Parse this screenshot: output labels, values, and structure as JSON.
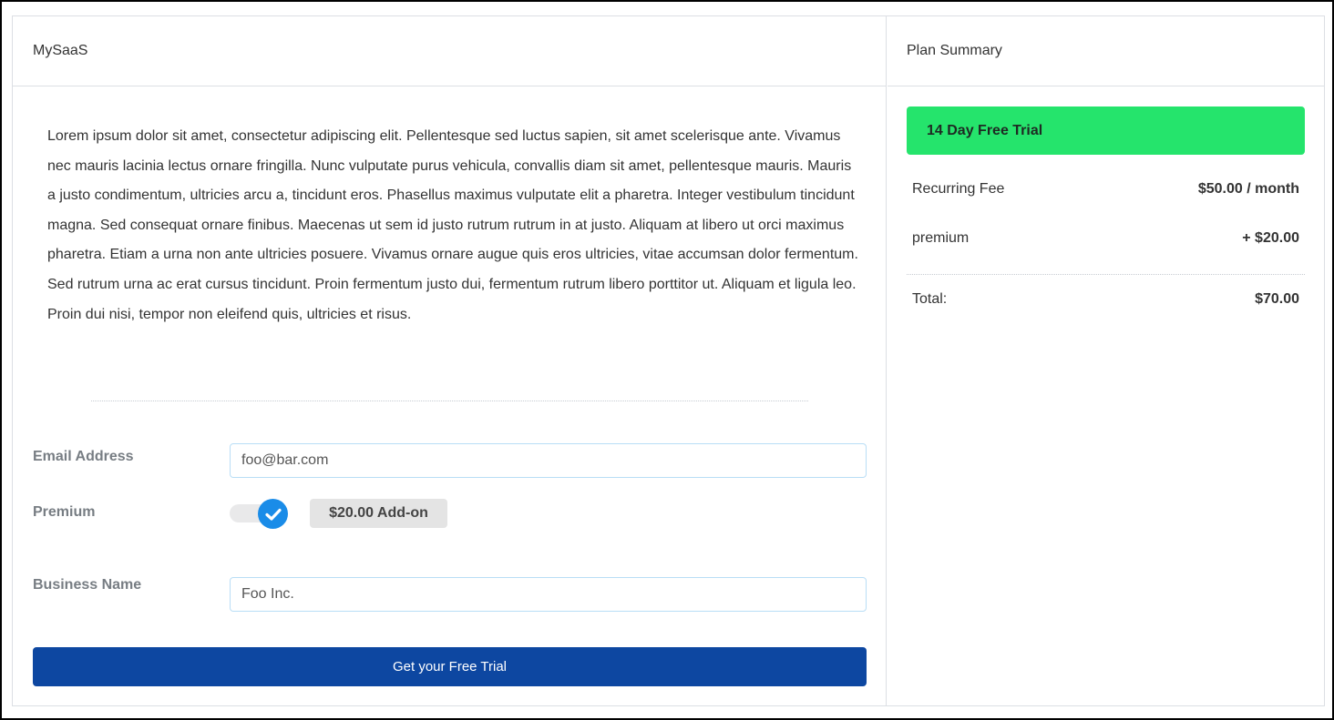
{
  "app": {
    "brand": "MySaaS"
  },
  "intro_text": "Lorem ipsum dolor sit amet, consectetur adipiscing elit. Pellentesque sed luctus sapien, sit amet scelerisque ante. Vivamus nec mauris lacinia lectus ornare fringilla. Nunc vulputate purus vehicula, convallis diam sit amet, pellentesque mauris. Mauris a justo condimentum, ultricies arcu a, tincidunt eros. Phasellus maximus vulputate elit a pharetra. Integer vestibulum tincidunt magna. Sed consequat ornare finibus. Maecenas ut sem id justo rutrum rutrum in at justo. Aliquam at libero ut orci maximus pharetra. Etiam a urna non ante ultricies posuere. Vivamus ornare augue quis eros ultricies, vitae accumsan dolor fermentum. Sed rutrum urna ac erat cursus tincidunt. Proin fermentum justo dui, fermentum rutrum libero porttitor ut. Aliquam et ligula leo. Proin dui nisi, tempor non eleifend quis, ultricies et risus.",
  "form": {
    "email": {
      "label": "Email Address",
      "value": "foo@bar.com"
    },
    "premium": {
      "label": "Premium",
      "checked": true,
      "addon_label": "$20.00 Add-on"
    },
    "business": {
      "label": "Business Name",
      "value": "Foo Inc."
    },
    "submit_label": "Get your Free Trial"
  },
  "summary": {
    "title": "Plan Summary",
    "trial_banner": "14 Day Free Trial",
    "lines": [
      {
        "label": "Recurring Fee",
        "value": "$50.00 / month"
      },
      {
        "label": "premium",
        "value": "+ $20.00"
      }
    ],
    "total": {
      "label": "Total:",
      "value": "$70.00"
    }
  },
  "colors": {
    "accent_button": "#0d47a1",
    "trial_banner": "#25e46c",
    "toggle_on": "#1a8ce8",
    "input_border": "#b9def6"
  },
  "icons": {
    "toggle_check": "check-icon"
  }
}
